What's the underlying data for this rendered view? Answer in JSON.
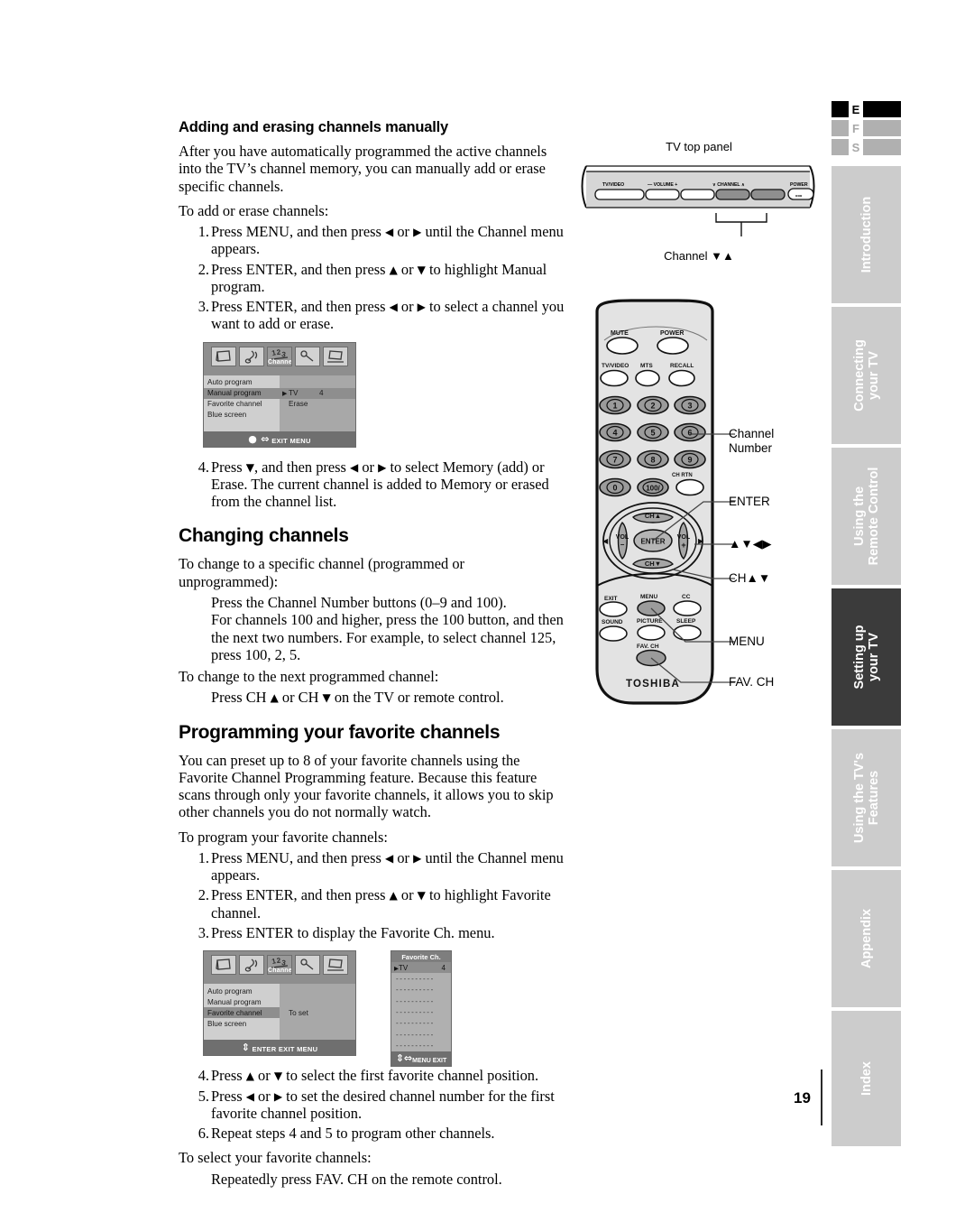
{
  "page": {
    "number": "19",
    "language_tabs": [
      {
        "letter": "E",
        "active": true
      },
      {
        "letter": "F",
        "active": false
      },
      {
        "letter": "S",
        "active": false
      }
    ],
    "nav_tabs": [
      {
        "label": "Introduction",
        "active": false
      },
      {
        "label": "Connecting\nyour TV",
        "active": false
      },
      {
        "label": "Using the\nRemote Control",
        "active": false
      },
      {
        "label": "Setting up\nyour TV",
        "active": true
      },
      {
        "label": "Using the TV's\nFeatures",
        "active": false
      },
      {
        "label": "Appendix",
        "active": false
      },
      {
        "label": "Index",
        "active": false
      }
    ]
  },
  "section1": {
    "heading": "Adding and erasing channels manually",
    "intro": "After you have automatically programmed the active channels into the TV’s channel memory, you can manually add or erase specific channels.",
    "lead": "To add or erase channels:",
    "steps": [
      {
        "num": "1.",
        "text_a": "Press MENU, and then press ",
        "arrow_a": "◀",
        "mid_a": " or ",
        "arrow_b": "▶",
        "text_b": " until the Channel menu appears."
      },
      {
        "num": "2.",
        "text_a": "Press ENTER, and then press ",
        "arrow_a": "▲",
        "mid_a": " or ",
        "arrow_b": "▼",
        "text_b": " to highlight Manual program."
      },
      {
        "num": "3.",
        "text_a": "Press ENTER, and then press ",
        "arrow_a": "◀",
        "mid_a": " or ",
        "arrow_b": "▶",
        "text_b": " to select a channel you want to add or erase."
      }
    ],
    "step4": {
      "num": "4.",
      "text_a": "Press ",
      "arrow_a": "▼",
      "mid_a": ", and then press ",
      "arrow_b": "◀",
      "mid_b": " or ",
      "arrow_c": "▶",
      "text_b": " to select Memory (add) or Erase. The current channel is added to Memory or erased from the channel list."
    }
  },
  "section2": {
    "heading": "Changing channels",
    "lead1": "To change to a specific channel (programmed or unprogrammed):",
    "body1_line1": "Press the Channel Number buttons (0–9 and 100).",
    "body1_line2": "For channels 100 and higher, press the 100 button, and then the next two numbers. For example, to select channel 125, press 100, 2, 5.",
    "lead2": "To change to the next programmed channel:",
    "body2_a": "Press CH ",
    "body2_arrow_a": "▲",
    "body2_mid": " or CH ",
    "body2_arrow_b": "▼",
    "body2_b": " on the TV or remote control."
  },
  "section3": {
    "heading": "Programming your favorite channels",
    "intro": "You can preset up to 8 of your favorite channels using the Favorite Channel Programming feature. Because this feature scans through only your favorite channels, it allows you to skip other channels you do not normally watch.",
    "lead": "To program your favorite channels:",
    "steps": [
      {
        "num": "1.",
        "text_a": "Press MENU, and then press ",
        "arrow_a": "◀",
        "mid_a": " or ",
        "arrow_b": "▶",
        "text_b": " until the Channel menu appears."
      },
      {
        "num": "2.",
        "text_a": "Press ENTER, and then press ",
        "arrow_a": "▲",
        "mid_a": " or ",
        "arrow_b": "▼",
        "text_b": " to highlight Favorite channel."
      }
    ],
    "step3": {
      "num": "3.",
      "text": "Press ENTER to display the Favorite Ch. menu."
    },
    "step4": {
      "num": "4.",
      "text_a": "Press ",
      "arrow_a": "▲",
      "mid_a": " or ",
      "arrow_b": "▼",
      "text_b": " to select the first favorite channel position."
    },
    "step5": {
      "num": "5.",
      "text_a": "Press ",
      "arrow_a": "◀",
      "mid_a": " or ",
      "arrow_b": "▶",
      "text_b": " to set the desired channel number for the first favorite channel position."
    },
    "step6": {
      "num": "6.",
      "text": "Repeat steps 4 and 5 to program other channels."
    },
    "lead2": "To select your favorite channels:",
    "body2": "Repeatedly press FAV. CH on the remote control."
  },
  "osd1": {
    "icons": [
      "picture-icon",
      "audio-icon",
      "channel-icon",
      "setup-icon",
      "display-icon"
    ],
    "icon_label": "Channel",
    "left_items": [
      {
        "label": "Auto program",
        "selected": false
      },
      {
        "label": "Manual program",
        "selected": true
      },
      {
        "label": "Favorite channel",
        "selected": false
      },
      {
        "label": "Blue screen",
        "selected": false
      }
    ],
    "right_items": [
      {
        "cursor": "▶",
        "label": "TV",
        "value": "4",
        "selected": true
      },
      {
        "cursor": "",
        "label": "Erase",
        "value": "",
        "selected": false
      }
    ],
    "footer": "EXIT MENU"
  },
  "osd2": {
    "icon_label": "Channel",
    "left_items": [
      {
        "label": "Auto program",
        "selected": false
      },
      {
        "label": "Manual program",
        "selected": false
      },
      {
        "label": "Favorite channel",
        "selected": true
      },
      {
        "label": "Blue screen",
        "selected": false
      }
    ],
    "right_items": [
      {
        "cursor": "",
        "label": "To set",
        "value": "",
        "selected": false
      }
    ],
    "footer": "ENTER EXIT MENU"
  },
  "fav_panel": {
    "header": "Favorite Ch.",
    "selected_row": {
      "cursor": "▶",
      "label": "TV",
      "value": "4"
    },
    "empty_rows": 7,
    "empty_text": "- - - - - - - - - -",
    "footer": "MENU EXIT"
  },
  "tv_panel_figure": {
    "title": "TV top panel",
    "buttons": [
      "TV/VIDEO",
      "— VOLUME +",
      "∨ CHANNEL ∧",
      "POWER"
    ],
    "caption": "Channel ▼▲"
  },
  "remote_figure": {
    "brand": "TOSHIBA",
    "top_buttons": [
      "MUTE",
      "POWER"
    ],
    "second_row": [
      "TV/VIDEO",
      "MTS",
      "RECALL"
    ],
    "keypad": [
      "1",
      "2",
      "3",
      "4",
      "5",
      "6",
      "7",
      "8",
      "9",
      "0",
      "100/"
    ],
    "ch_rtn": "CH RTN",
    "dpad": {
      "up": "CH▲",
      "down": "CH▼",
      "left": "VOL\n−",
      "right": "VOL\n+",
      "center": "ENTER"
    },
    "bottom_row1": [
      "EXIT",
      "MENU",
      "CC"
    ],
    "bottom_row2": [
      "SOUND",
      "PICTURE",
      "SLEEP"
    ],
    "fav_button": "FAV. CH",
    "callouts": [
      {
        "label": "Channel",
        "label2": "Number"
      },
      {
        "label": "ENTER"
      },
      {
        "label": "▲▼◀▶"
      },
      {
        "label": "CH▲▼"
      },
      {
        "label": "MENU"
      },
      {
        "label": "FAV. CH"
      }
    ]
  }
}
